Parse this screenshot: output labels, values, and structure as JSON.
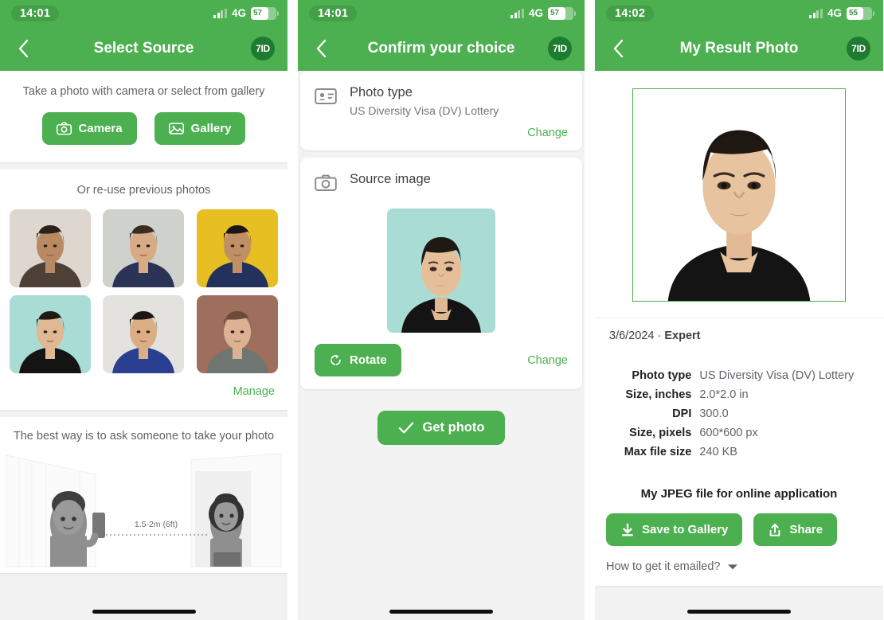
{
  "theme": {
    "green": "#4CAF50",
    "logo_green": "#1f7a32",
    "text": "#3c4043",
    "muted": "#5f6368"
  },
  "screen1": {
    "status": {
      "time": "14:01",
      "network": "4G",
      "battery": "57"
    },
    "nav": {
      "title": "Select Source",
      "logo": "7ID",
      "back_icon": "chevron-left-icon"
    },
    "capture": {
      "hint": "Take a photo with camera or select from gallery",
      "camera_label": "Camera",
      "gallery_label": "Gallery"
    },
    "previous": {
      "title": "Or re-use previous photos",
      "manage_label": "Manage",
      "thumbs": [
        {
          "name": "bearded-man-in-suit",
          "bg": "#ded7d0",
          "skin": "#b98a62",
          "hair": "#2a211c",
          "cloth": "#4e4037"
        },
        {
          "name": "woman-floral-dress",
          "bg": "#cfd2cc",
          "skin": "#d8ab86",
          "hair": "#3a2b23",
          "cloth": "#2b3356"
        },
        {
          "name": "woman-yellow-curtain",
          "bg": "#e8bf22",
          "skin": "#c08f66",
          "hair": "#1c1512",
          "cloth": "#23325c"
        },
        {
          "name": "woman-teal-background",
          "bg": "#a9dcd4",
          "skin": "#e0b893",
          "hair": "#201813",
          "cloth": "#141414"
        },
        {
          "name": "man-blue-shirt",
          "bg": "#e3e2de",
          "skin": "#dcae85",
          "hair": "#1b1613",
          "cloth": "#2a3f8f"
        },
        {
          "name": "woman-brown-background",
          "bg": "#9e6f5c",
          "skin": "#ddb294",
          "hair": "#6b4a3a",
          "cloth": "#6f7570"
        }
      ]
    },
    "tip": {
      "title": "The best way is to ask someone to take your photo",
      "distance_label": "1.5-2m (6ft)"
    }
  },
  "screen2": {
    "status": {
      "time": "14:01",
      "network": "4G",
      "battery": "57"
    },
    "nav": {
      "title": "Confirm your choice",
      "logo": "7ID",
      "back_icon": "chevron-left-icon"
    },
    "photo_type": {
      "icon": "id-card-icon",
      "title": "Photo type",
      "value": "US Diversity Visa (DV) Lottery",
      "change_label": "Change"
    },
    "source_image": {
      "icon": "camera-icon",
      "title": "Source image",
      "rotate_label": "Rotate",
      "change_label": "Change"
    },
    "get_photo_label": "Get photo"
  },
  "screen3": {
    "status": {
      "time": "14:02",
      "network": "4G",
      "battery": "55"
    },
    "nav": {
      "title": "My Result Photo",
      "logo": "7ID",
      "back_icon": "chevron-left-icon"
    },
    "meta": {
      "date": "3/6/2024",
      "separator": "·",
      "plan": "Expert"
    },
    "specs": [
      {
        "key": "Photo type",
        "value": "US Diversity Visa (DV) Lottery"
      },
      {
        "key": "Size, inches",
        "value": "2.0*2.0 in"
      },
      {
        "key": "DPI",
        "value": "300.0"
      },
      {
        "key": "Size, pixels",
        "value": "600*600 px"
      },
      {
        "key": "Max file size",
        "value": "240 KB"
      }
    ],
    "jpeg_title": "My JPEG file for online application",
    "save_label": "Save to Gallery",
    "share_label": "Share",
    "email_label": "How to get it emailed?"
  }
}
